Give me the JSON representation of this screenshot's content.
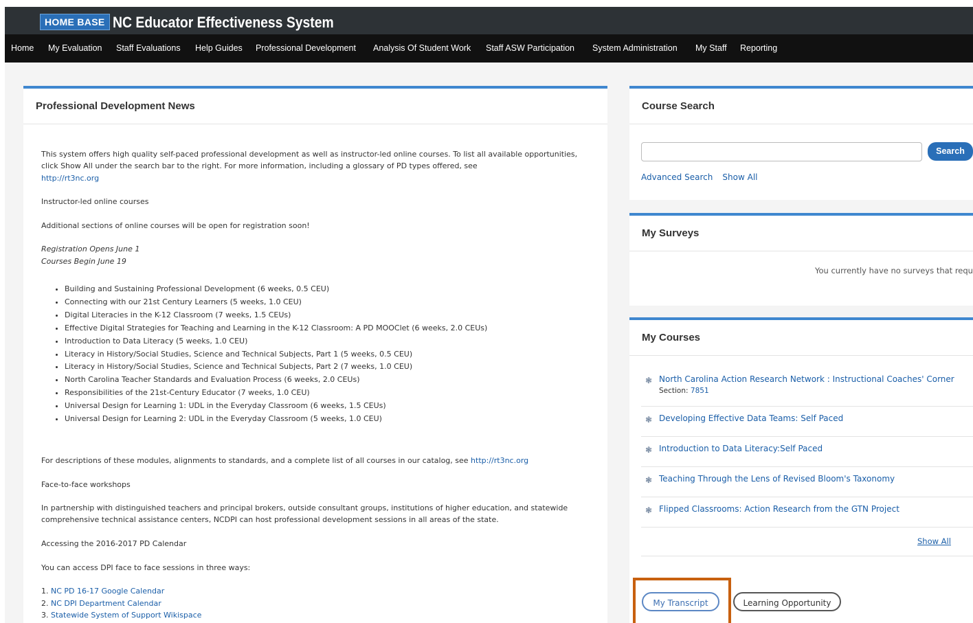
{
  "header": {
    "logo_text": "HOME BASE",
    "app_title": "NC Educator Effectiveness System"
  },
  "nav": {
    "items": [
      "Home",
      "My Evaluation",
      "Staff Evaluations",
      "Help Guides",
      "Professional Development",
      "Analysis Of Student Work",
      "Staff ASW Participation",
      "System Administration",
      "My Staff",
      "Reporting"
    ]
  },
  "news": {
    "title": "Professional Development News",
    "intro": "This system offers high quality self-paced professional development as well as instructor-led online courses. To list all available opportunities, click Show All under the search bar to the right. For more information, including a glossary of PD types offered, see",
    "intro_link": "http://rt3nc.org",
    "instructor_heading": "Instructor-led online courses",
    "additional_sections": "Additional sections of online courses will be open for registration soon!",
    "registration_opens": "Registration Opens June 1",
    "courses_begin": "Courses Begin June 19",
    "course_list": [
      "Building and Sustaining Professional Development (6 weeks, 0.5 CEU)",
      "Connecting with our 21st Century Learners (5 weeks, 1.0 CEU)",
      "Digital Literacies in the K-12 Classroom (7 weeks, 1.5 CEUs)",
      "Effective Digital Strategies for Teaching and Learning in the K-12 Classroom: A PD MOOClet (6 weeks, 2.0 CEUs)",
      "Introduction to Data Literacy (5 weeks, 1.0 CEU)",
      "Literacy in History/Social Studies, Science and Technical Subjects, Part 1 (5 weeks, 0.5 CEU)",
      "Literacy in History/Social Studies, Science and Technical Subjects, Part 2 (7 weeks, 1.0 CEU)",
      "North Carolina Teacher Standards and Evaluation Process (6 weeks, 2.0 CEUs)",
      "Responsibilities of the 21st-Century Educator (7 weeks, 1.0 CEU)",
      "Universal Design for Learning 1: UDL in the Everyday Classroom (6 weeks, 1.5 CEUs)",
      "Universal Design for Learning 2: UDL in the Everyday Classroom (5 weeks, 1.0 CEU)"
    ],
    "descriptions_text": "For descriptions of these modules, alignments to standards, and a complete list of all courses in our catalog, see",
    "descriptions_link": "http://rt3nc.org",
    "face_to_face_heading": "Face-to-face workshops",
    "partnership_text": "In partnership with distinguished teachers and principal brokers, outside consultant groups, institutions of higher education, and statewide comprehensive technical assistance centers, NCDPI can host professional development sessions in all areas of the state.",
    "accessing_calendar": "Accessing the 2016-2017 PD Calendar",
    "access_ways": "You can access DPI face to face sessions in three ways:",
    "ways": [
      {
        "num": "1.",
        "label": "NC PD 16-17 Google Calendar"
      },
      {
        "num": "2.",
        "label": "NC DPI Department Calendar"
      },
      {
        "num": "3.",
        "label": "Statewide System of Support Wikispace"
      }
    ]
  },
  "course_search": {
    "title": "Course Search",
    "search_value": "",
    "search_button": "Search",
    "advanced_search": "Advanced Search",
    "show_all": "Show All"
  },
  "surveys": {
    "title": "My Surveys",
    "message": "You currently have no surveys that require"
  },
  "my_courses": {
    "title": "My Courses",
    "items": [
      {
        "name": "North Carolina Action Research Network : Instructional Coaches' Corner",
        "section_label": "Section:",
        "section_value": "7851"
      },
      {
        "name": "Developing Effective Data Teams: Self Paced"
      },
      {
        "name": "Introduction to Data Literacy:Self Paced"
      },
      {
        "name": "Teaching Through the Lens of Revised Bloom's Taxonomy"
      },
      {
        "name": "Flipped Classrooms: Action Research from the GTN Project"
      }
    ],
    "show_all": "Show All"
  },
  "actions": {
    "my_transcript": "My Transcript",
    "learning_opportunity": "Learning Opportunity"
  },
  "colors": {
    "accent_blue": "#3f87cf",
    "link_blue": "#1a5ea8",
    "highlight_orange": "#c8600f",
    "topbar": "#2d3236",
    "navbar": "#111111"
  }
}
